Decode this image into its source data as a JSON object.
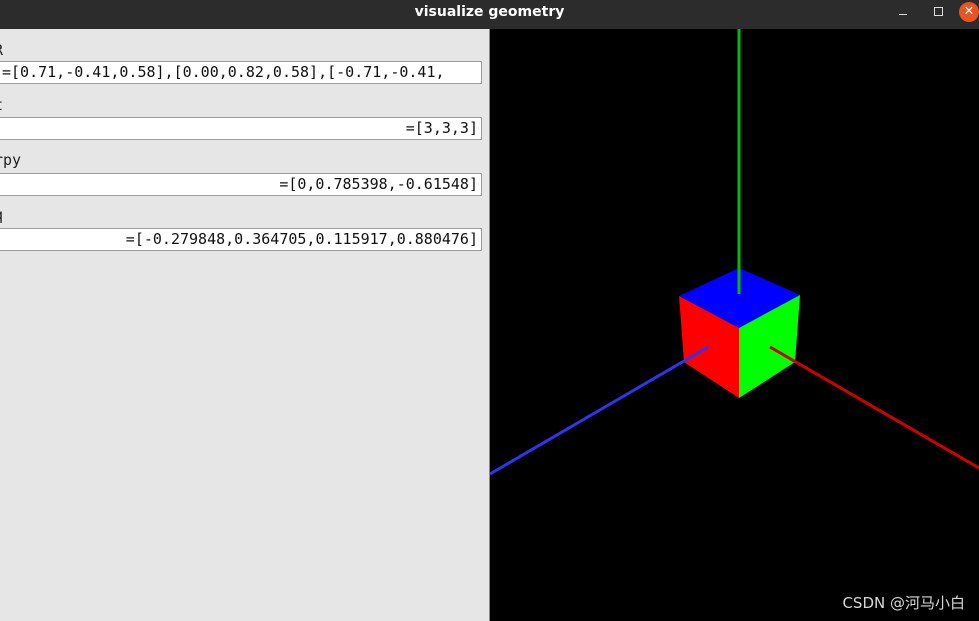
{
  "window": {
    "title": "visualize geometry"
  },
  "fields": [
    {
      "label": "R",
      "value": "=[0.71,-0.41,0.58],[0.00,0.82,0.58],[-0.71,-0.41,"
    },
    {
      "label": "t",
      "value": "=[3,3,3]"
    },
    {
      "label": "rpy",
      "value": "=[0,0.785398,-0.61548]"
    },
    {
      "label": "q",
      "value": "=[-0.279848,0.364705,0.115917,0.880476]"
    }
  ],
  "viewport": {
    "background": "#000000",
    "cube_colors": {
      "top": "#0000ff",
      "left": "#ff0000",
      "right": "#00ff00"
    },
    "axis_colors": {
      "x": "#cc0000",
      "y": "#2222dd",
      "z": "#00bb00"
    }
  },
  "watermark": "CSDN @河马小白"
}
